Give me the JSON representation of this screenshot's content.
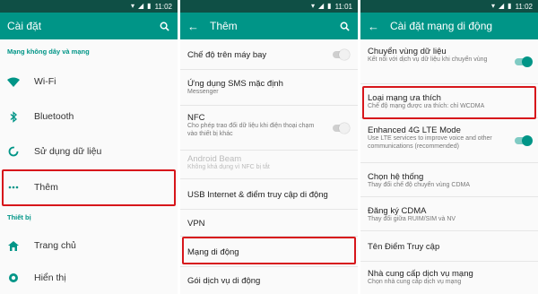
{
  "colors": {
    "appbar": "#009587",
    "statusbar": "#0f4f45",
    "accent": "#009587",
    "highlight": "#d7161b"
  },
  "panel1": {
    "time": "11:02",
    "title": "Cài đặt",
    "section_wireless": "Mạng không dây và mạng",
    "items": [
      {
        "label": "Wi-Fi",
        "icon": "wifi-icon"
      },
      {
        "label": "Bluetooth",
        "icon": "bluetooth-icon"
      },
      {
        "label": "Sử dụng dữ liệu",
        "icon": "data-usage-icon"
      },
      {
        "label": "Thêm",
        "icon": "more-icon"
      }
    ],
    "section_device": "Thiết bị",
    "device_items": [
      {
        "label": "Trang chủ",
        "icon": "home-icon"
      },
      {
        "label": "Hiển thị",
        "icon": "display-icon"
      }
    ]
  },
  "panel2": {
    "time": "11:01",
    "title": "Thêm",
    "rows": [
      {
        "title": "Chế độ trên máy bay",
        "subtitle": ""
      },
      {
        "title": "Ứng dụng SMS mặc định",
        "subtitle": "Messenger"
      },
      {
        "title": "NFC",
        "subtitle": "Cho phép trao đổi dữ liệu khi điện thoại chạm vào thiết bị khác"
      },
      {
        "title": "Android Beam",
        "subtitle": "Không khả dụng vì NFC bị tắt"
      },
      {
        "title": "USB Internet & điểm truy cập di động",
        "subtitle": ""
      },
      {
        "title": "VPN",
        "subtitle": ""
      },
      {
        "title": "Mạng di động",
        "subtitle": ""
      },
      {
        "title": "Gói dịch vụ di động",
        "subtitle": ""
      }
    ]
  },
  "panel3": {
    "time": "11:02",
    "title": "Cài đặt mạng di động",
    "rows": [
      {
        "title": "Chuyển vùng dữ liệu",
        "subtitle": "Kết nối với dịch vụ dữ liệu khi chuyển vùng"
      },
      {
        "title": "Loại mạng ưa thích",
        "subtitle": "Chế độ mạng được ưa thích: chỉ WCDMA"
      },
      {
        "title": "Enhanced 4G LTE Mode",
        "subtitle": "Use LTE services to improve voice and other communications (recommended)"
      },
      {
        "title": "Chọn hệ thống",
        "subtitle": "Thay đổi chế độ chuyển vùng CDMA"
      },
      {
        "title": "Đăng ký CDMA",
        "subtitle": "Thay đổi giữa RUIM/SIM và NV"
      },
      {
        "title": "Tên Điểm Truy cập",
        "subtitle": ""
      },
      {
        "title": "Nhà cung cấp dịch vụ mạng",
        "subtitle": "Chọn nhà cung cấp dịch vụ mạng"
      }
    ]
  }
}
